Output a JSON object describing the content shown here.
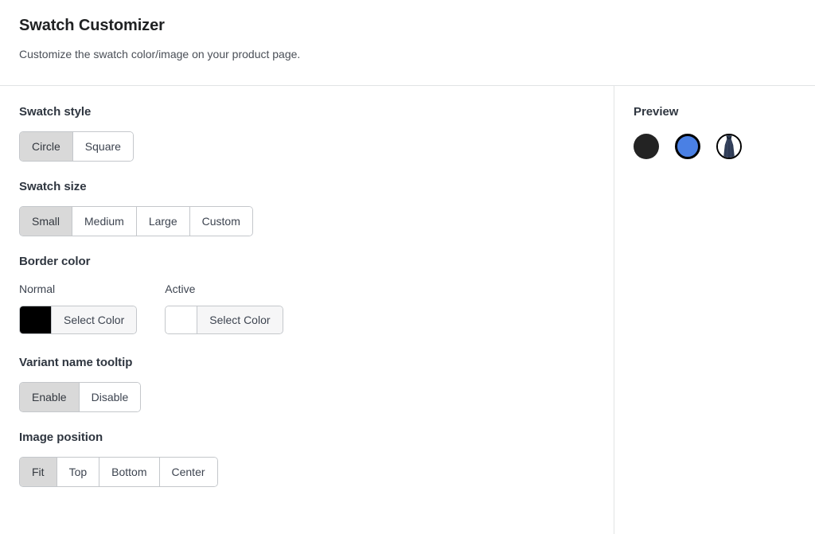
{
  "header": {
    "title": "Swatch Customizer",
    "subtitle": "Customize the swatch color/image on your product page."
  },
  "settings": {
    "swatch_style": {
      "label": "Swatch style",
      "options": [
        "Circle",
        "Square"
      ],
      "selected": "Circle"
    },
    "swatch_size": {
      "label": "Swatch size",
      "options": [
        "Small",
        "Medium",
        "Large",
        "Custom"
      ],
      "selected": "Small"
    },
    "border_color": {
      "label": "Border color",
      "normal": {
        "label": "Normal",
        "color": "#000000",
        "button_label": "Select Color"
      },
      "active": {
        "label": "Active",
        "color": "#ffffff",
        "button_label": "Select Color"
      }
    },
    "variant_name_tooltip": {
      "label": "Variant name tooltip",
      "options": [
        "Enable",
        "Disable"
      ],
      "selected": "Enable"
    },
    "image_position": {
      "label": "Image position",
      "options": [
        "Fit",
        "Top",
        "Bottom",
        "Center"
      ],
      "selected": "Fit"
    }
  },
  "preview": {
    "title": "Preview",
    "swatches": [
      {
        "name": "swatch-preview-dark",
        "type": "solid",
        "color": "#232323",
        "border": "none"
      },
      {
        "name": "swatch-preview-blue-active",
        "type": "solid",
        "color": "#4a80e4",
        "border": "#000000"
      },
      {
        "name": "swatch-preview-image",
        "type": "image",
        "color": "#2d3a52",
        "border": "#000000"
      }
    ]
  }
}
